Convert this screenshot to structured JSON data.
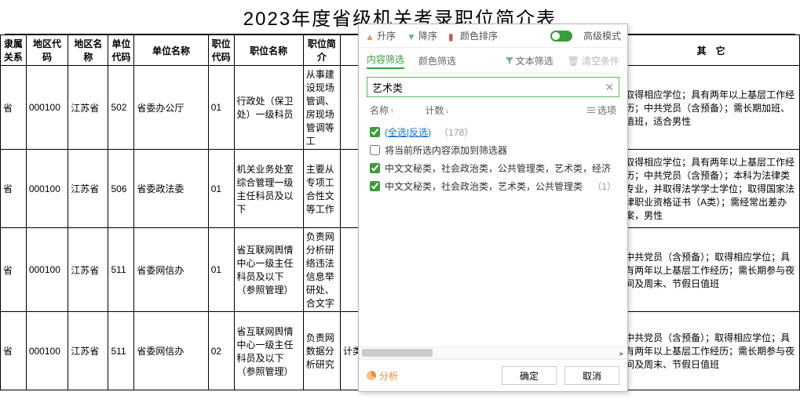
{
  "title": "2023年度省级机关考录职位简介表",
  "headers": [
    "隶属关系",
    "地区代码",
    "地区名称",
    "单位代码",
    "单位名称",
    "职位代码",
    "职位名称",
    "职位简介",
    "",
    "其　它"
  ],
  "rows": [
    {
      "c0": "省",
      "c1": "000100",
      "c2": "江苏省",
      "c3": "502",
      "c4": "省委办公厅",
      "c5": "01",
      "c6": "行政处（保卫处）一级科员",
      "c7": "从事建设现场管调、房现场管调等工",
      "c9": "取得相应学位；具有两年以上基层工作经历；中共党员（含预备）；需长期加班、值班，适合男性"
    },
    {
      "c0": "省",
      "c1": "000100",
      "c2": "江苏省",
      "c3": "506",
      "c4": "省委政法委",
      "c5": "01",
      "c6": "机关业务处室综合管理一级主任科员及以下",
      "c7": "主要从专项工合性文等工作",
      "c9": "取得相应学位；具有两年以上基层工作经历；中共党员（含预备）；本科为法律类专业，并取得法学学士学位；取得国家法律职业资格证书（A类）；需经常出差办案，男性"
    },
    {
      "c0": "省",
      "c1": "000100",
      "c2": "江苏省",
      "c3": "511",
      "c4": "省委网信办",
      "c5": "01",
      "c6": "省互联网舆情中心一级主任科员及以下（参照管理）",
      "c7": "负责网分析研络违法信息举研处、合文字",
      "c9": "中共党员（含预备）；取得相应学位；具有两年以上基层工作经历；需长期参与夜间及周末、节假日值班"
    },
    {
      "c0": "省",
      "c1": "000100",
      "c2": "江苏省",
      "c3": "511",
      "c4": "省委网信办",
      "c5": "02",
      "c6": "省互联网舆情中心一级主任科员及以下（参照管理）",
      "c7": "负责网数据分析研究",
      "c8": "计类",
      "c9": "中共党员（含预备）；取得相应学位；具有两年以上基层工作经历；需长期参与夜间及周末、节假日值班"
    }
  ],
  "filter": {
    "toolbar": {
      "asc": "升序",
      "desc": "降序",
      "color_sort": "颜色排序",
      "advanced": "高级模式"
    },
    "tabs": {
      "content": "内容筛选",
      "color": "颜色筛选",
      "text_filter": "文本筛选",
      "clear": "清空条件"
    },
    "search_value": "艺术类",
    "list_headers": {
      "name": "名称",
      "count": "计数",
      "options": "选项"
    },
    "select_all": "全选",
    "invert": "反选",
    "total_count": "（178）",
    "add_to_filter": "将当前所选内容添加到筛选器",
    "items": [
      {
        "text": "中文文秘类，社会政治类，公共管理类，艺术类，经济",
        "count": ""
      },
      {
        "text": "中文文秘类，社会政治类，艺术类，公共管理类",
        "count": "（1）"
      }
    ],
    "analysis": "分析",
    "ok": "确定",
    "cancel": "取消"
  }
}
